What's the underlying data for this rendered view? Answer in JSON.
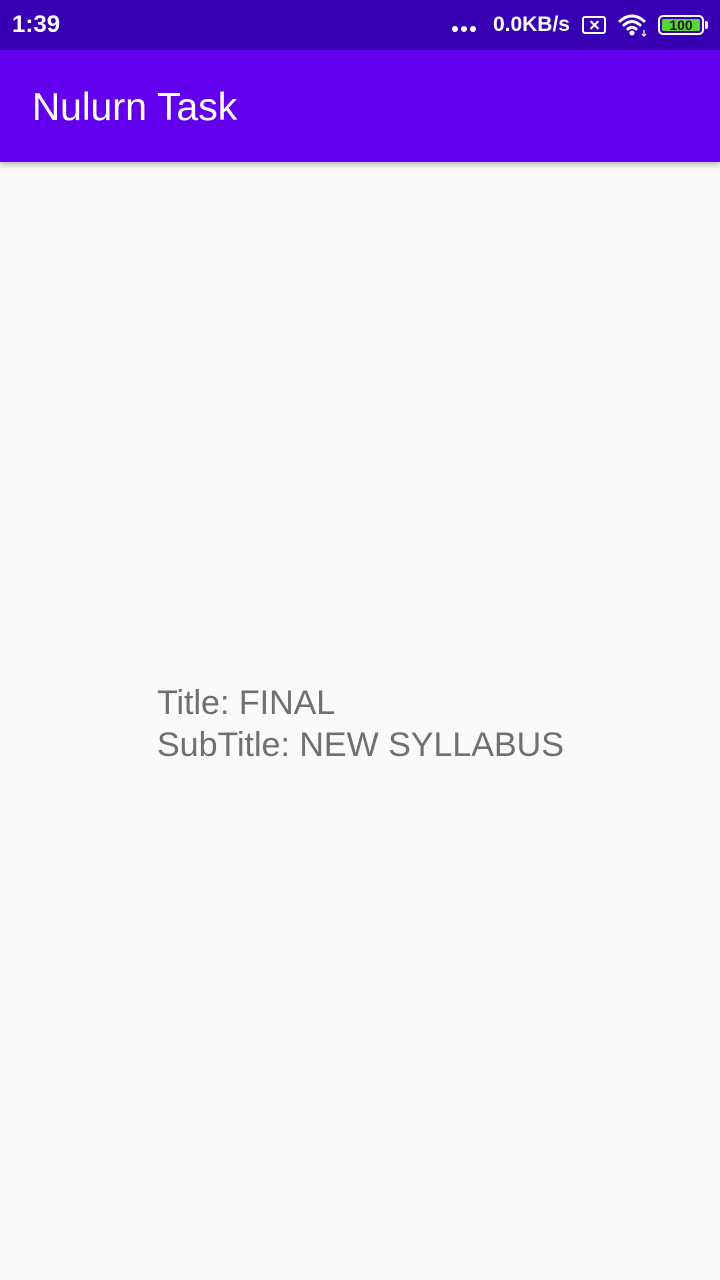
{
  "status_bar": {
    "time": "1:39",
    "net_speed": "0.0KB/s",
    "battery_level": "100",
    "icons": [
      "more-dots-icon",
      "no-sim-icon",
      "wifi-icon",
      "battery-icon"
    ],
    "bg_color": "#3700b3"
  },
  "app_bar": {
    "title": "Nulurn Task",
    "bg_color": "#6200ee"
  },
  "content": {
    "title_line": "Title: FINAL",
    "subtitle_line": "SubTitle: NEW SYLLABUS",
    "text_color": "#707070"
  }
}
